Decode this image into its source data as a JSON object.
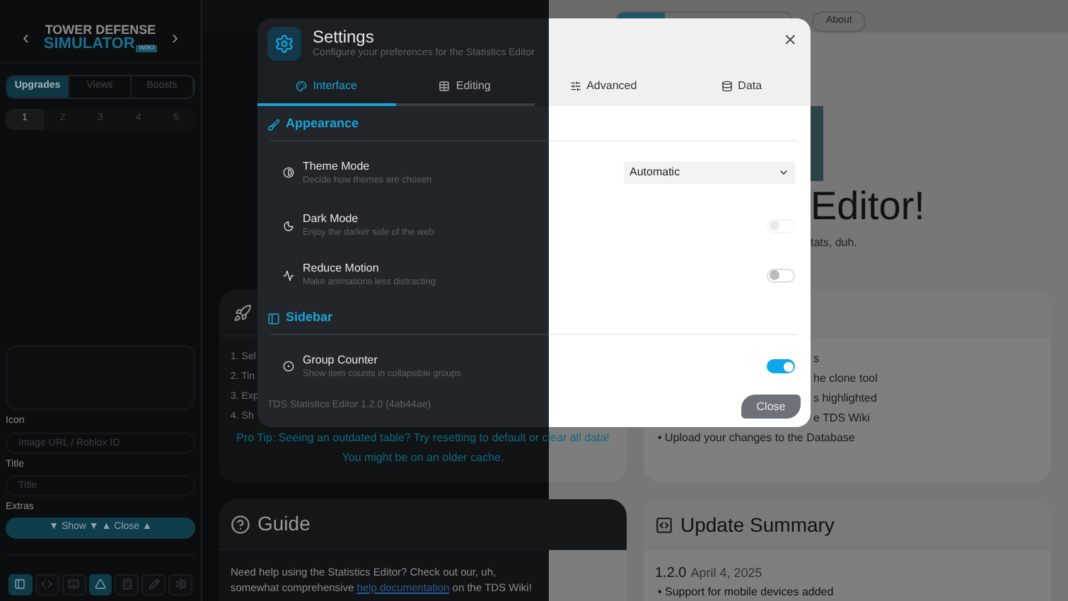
{
  "sidebar": {
    "logo": {
      "line1": "TOWER DEFENSE",
      "line2": "SIMULATOR",
      "badge": "WIKI",
      "prev": "‹",
      "next": "›"
    },
    "tabs": [
      {
        "label": "Upgrades",
        "selected": true
      },
      {
        "label": "Views",
        "selected": false
      },
      {
        "label": "Boosts",
        "selected": false
      }
    ],
    "levels": [
      {
        "label": "1",
        "selected": true
      },
      {
        "label": "2",
        "selected": false
      },
      {
        "label": "3",
        "selected": false
      },
      {
        "label": "4",
        "selected": false
      },
      {
        "label": "5",
        "selected": false
      }
    ],
    "fields": [
      {
        "label": "Icon",
        "placeholder": "Image URL / Roblox ID"
      },
      {
        "label": "Title",
        "placeholder": "Title"
      }
    ],
    "extras": {
      "label": "Extras",
      "button": "▼ Show ▼ ▲ Close ▲"
    },
    "toolbar": [
      {
        "selected": true
      },
      {
        "selected": false
      },
      {
        "selected": false
      },
      {
        "selected": true
      },
      {
        "selected": false
      },
      {
        "selected": false
      },
      {
        "selected": false
      }
    ]
  },
  "header": {
    "about": "About"
  },
  "hero": {
    "title": "Editor!",
    "subtitle": "tats, duh."
  },
  "steps_card": {
    "items": [
      "1. Sel",
      "2. Tin",
      "3. Exp",
      "4. Sh"
    ],
    "tip": "Pro Tip: Seeing an outdated table? Try resetting to default or clear all data! You might be on an older cache."
  },
  "features_card": {
    "items": [
      "s",
      "he clone tool",
      "s highlighted",
      "e TDS Wiki",
      "• Upload your changes to the Database"
    ]
  },
  "guide": {
    "title": "Guide",
    "text_before": "Need help using the Statistics Editor? Check out our, uh, somewhat comprehensive ",
    "link": "help documentation",
    "text_after": " on the TDS Wiki!"
  },
  "updates": {
    "title": "Update Summary",
    "version": "1.2.0",
    "date": "April 4, 2025",
    "items": [
      "• Support for mobile devices added"
    ]
  },
  "settings": {
    "title": "Settings",
    "subtitle": "Configure your preferences for the Statistics Editor",
    "close": "×",
    "tabs": [
      {
        "label": "Interface",
        "selected": true
      },
      {
        "label": "Editing",
        "selected": false
      },
      {
        "label": "Advanced",
        "selected": false
      },
      {
        "label": "Data",
        "selected": false
      }
    ],
    "sections": [
      {
        "title": "Appearance",
        "rows": [
          {
            "kind": "select",
            "title": "Theme Mode",
            "description": "Decide how themes are chosen",
            "value": "Automatic"
          },
          {
            "kind": "toggle",
            "title": "Dark Mode",
            "description": "Enjoy the darker side of the web",
            "on": false,
            "disabled": true
          },
          {
            "kind": "toggle",
            "title": "Reduce Motion",
            "description": "Make animations less distracting",
            "on": false,
            "disabled": false
          }
        ]
      },
      {
        "title": "Sidebar",
        "rows": [
          {
            "kind": "toggle",
            "title": "Group Counter",
            "description": "Show item counts in collapsible groups",
            "on": true,
            "disabled": false
          }
        ]
      }
    ],
    "version": "TDS Statistics Editor 1.2.0 (4ab44ae)",
    "close_button": "Close"
  }
}
